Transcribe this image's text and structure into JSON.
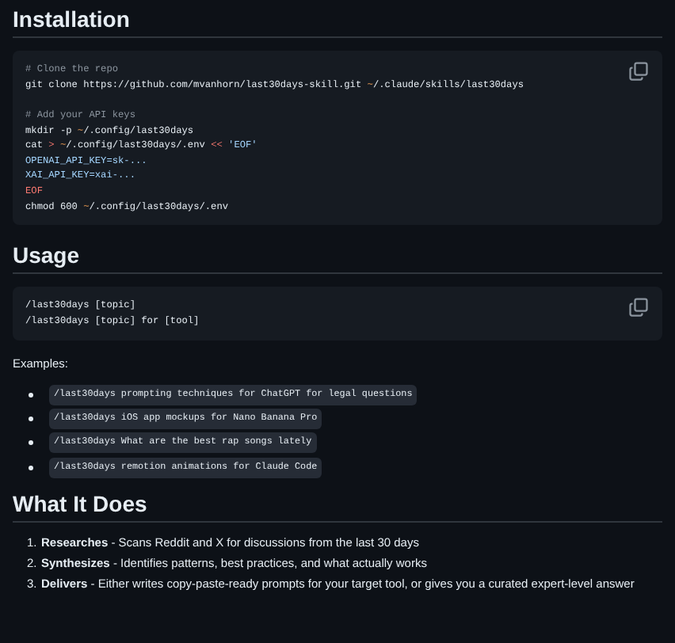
{
  "sections": [
    {
      "heading": "Installation",
      "blocks": [
        {
          "kind": "code",
          "copy_button": true,
          "groups": [
            [
              [
                {
                  "kind": "comment",
                  "text": "# Clone the repo"
                }
              ],
              [
                {
                  "kind": "plain",
                  "text": "git clone https://github.com/mvanhorn/last30days-skill.git "
                },
                {
                  "kind": "path",
                  "text": "~"
                },
                {
                  "kind": "plain",
                  "text": "/.claude/skills/last30days"
                }
              ]
            ],
            [
              [
                {
                  "kind": "comment",
                  "text": "# Add your API keys"
                }
              ],
              [
                {
                  "kind": "plain",
                  "text": "mkdir -p "
                },
                {
                  "kind": "path",
                  "text": "~"
                },
                {
                  "kind": "plain",
                  "text": "/.config/last30days"
                }
              ],
              [
                {
                  "kind": "plain",
                  "text": "cat "
                },
                {
                  "kind": "operator",
                  "text": "> "
                },
                {
                  "kind": "path",
                  "text": "~"
                },
                {
                  "kind": "plain",
                  "text": "/.config/last30days/.env "
                },
                {
                  "kind": "operator",
                  "text": "<< "
                },
                {
                  "kind": "string",
                  "text": "'EOF'"
                }
              ],
              [
                {
                  "kind": "heredoc",
                  "text": "OPENAI_API_KEY=sk-..."
                }
              ],
              [
                {
                  "kind": "heredoc",
                  "text": "XAI_API_KEY=xai-..."
                }
              ],
              [
                {
                  "kind": "operator",
                  "text": "EOF"
                }
              ],
              [
                {
                  "kind": "plain",
                  "text": "chmod 600 "
                },
                {
                  "kind": "path",
                  "text": "~"
                },
                {
                  "kind": "plain",
                  "text": "/.config/last30days/.env"
                }
              ]
            ]
          ]
        }
      ]
    },
    {
      "heading": "Usage",
      "blocks": [
        {
          "kind": "code",
          "copy_button": true,
          "groups": [
            [
              [
                {
                  "kind": "plain",
                  "text": "/last30days [topic]"
                }
              ],
              [
                {
                  "kind": "plain",
                  "text": "/last30days [topic] for [tool]"
                }
              ]
            ]
          ]
        },
        {
          "kind": "paragraph",
          "text": "Examples:"
        },
        {
          "kind": "bullet-list",
          "items": [
            "/last30days prompting techniques for ChatGPT for legal questions",
            "/last30days iOS app mockups for Nano Banana Pro",
            "/last30days What are the best rap songs lately",
            "/last30days remotion animations for Claude Code"
          ]
        }
      ]
    },
    {
      "heading": "What It Does",
      "blocks": [
        {
          "kind": "ordered-list",
          "items": [
            {
              "number": "1.",
              "text": "**Researches** - Scans Reddit and X for discussions from the last 30 days"
            },
            {
              "number": "2.",
              "text": "**Synthesizes** - Identifies patterns, best practices, and what actually works"
            },
            {
              "number": "3.",
              "text": "**Delivers** - Either writes copy-paste-ready prompts for your target tool, or gives you a curated expert-level answer"
            }
          ]
        }
      ]
    }
  ]
}
